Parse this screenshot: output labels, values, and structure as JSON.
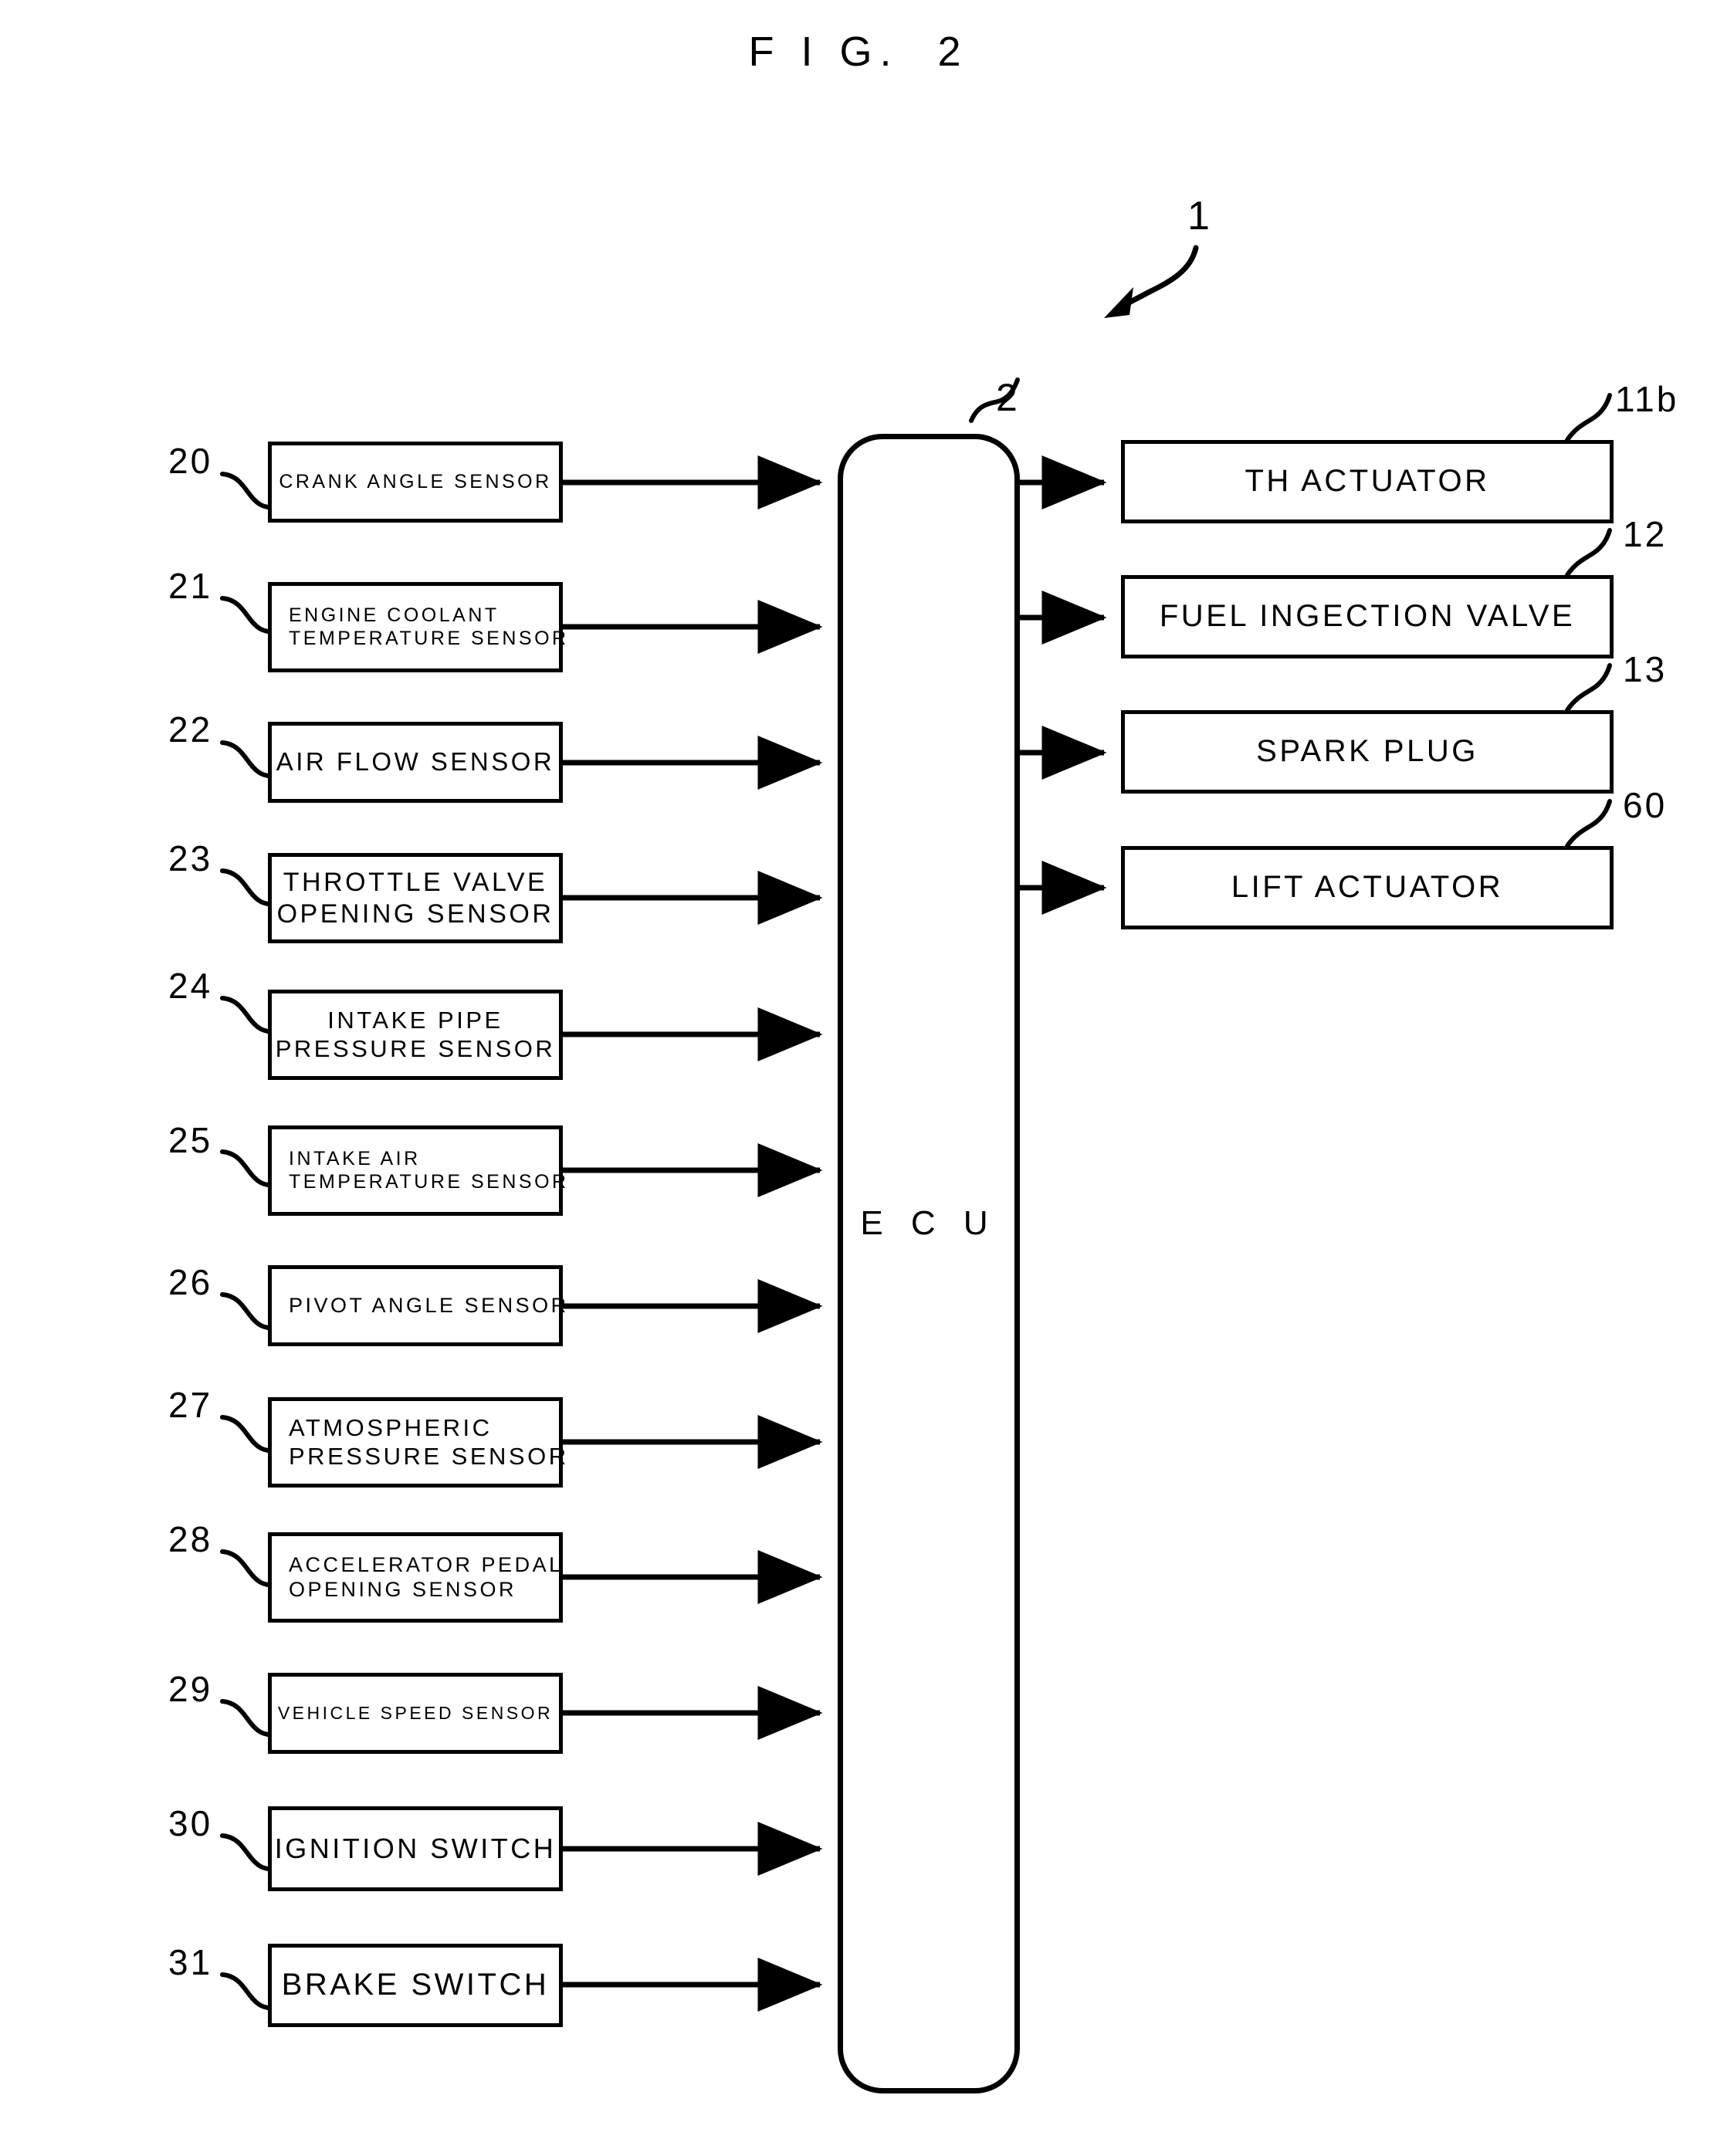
{
  "figure": {
    "title": "F I G.  2",
    "assembly_ref": "1",
    "controller_ref": "2",
    "controller_label": "E C U"
  },
  "inputs": [
    {
      "ref": "20",
      "label": "CRANK ANGLE SENSOR",
      "lines": [
        "CRANK ANGLE SENSOR"
      ],
      "align": "center"
    },
    {
      "ref": "21",
      "label": "ENGINE COOLANT TEMPERATURE SENSOR",
      "lines": [
        "ENGINE COOLANT",
        "TEMPERATURE SENSOR"
      ],
      "align": "left"
    },
    {
      "ref": "22",
      "label": "AIR FLOW SENSOR",
      "lines": [
        "AIR FLOW SENSOR"
      ],
      "align": "center"
    },
    {
      "ref": "23",
      "label": "THROTTLE VALVE OPENING SENSOR",
      "lines": [
        "THROTTLE VALVE",
        "OPENING SENSOR"
      ],
      "align": "center"
    },
    {
      "ref": "24",
      "label": "INTAKE PIPE PRESSURE SENSOR",
      "lines": [
        "INTAKE PIPE",
        "PRESSURE SENSOR"
      ],
      "align": "center"
    },
    {
      "ref": "25",
      "label": "INTAKE AIR TEMPERATURE SENSOR",
      "lines": [
        "INTAKE AIR",
        "TEMPERATURE SENSOR"
      ],
      "align": "left"
    },
    {
      "ref": "26",
      "label": "PIVOT ANGLE SENSOR",
      "lines": [
        "PIVOT ANGLE SENSOR"
      ],
      "align": "left"
    },
    {
      "ref": "27",
      "label": "ATMOSPHERIC PRESSURE SENSOR",
      "lines": [
        "ATMOSPHERIC",
        "PRESSURE SENSOR"
      ],
      "align": "left"
    },
    {
      "ref": "28",
      "label": "ACCELERATOR PEDAL OPENING SENSOR",
      "lines": [
        "ACCELERATOR PEDAL",
        "OPENING SENSOR"
      ],
      "align": "left"
    },
    {
      "ref": "29",
      "label": "VEHICLE SPEED SENSOR",
      "lines": [
        "VEHICLE SPEED SENSOR"
      ],
      "align": "center"
    },
    {
      "ref": "30",
      "label": "IGNITION SWITCH",
      "lines": [
        "IGNITION SWITCH"
      ],
      "align": "center"
    },
    {
      "ref": "31",
      "label": "BRAKE SWITCH",
      "lines": [
        "BRAKE SWITCH"
      ],
      "align": "center"
    }
  ],
  "outputs": [
    {
      "ref": "11b",
      "label": "TH ACTUATOR",
      "lines": [
        "TH ACTUATOR"
      ]
    },
    {
      "ref": "12",
      "label": "FUEL INGECTION VALVE",
      "lines": [
        "FUEL INGECTION VALVE"
      ]
    },
    {
      "ref": "13",
      "label": "SPARK PLUG",
      "lines": [
        "SPARK PLUG"
      ]
    },
    {
      "ref": "60",
      "label": "LIFT ACTUATOR",
      "lines": [
        "LIFT ACTUATOR"
      ]
    }
  ],
  "colors": {
    "ink": "#000000",
    "paper": "#ffffff"
  }
}
